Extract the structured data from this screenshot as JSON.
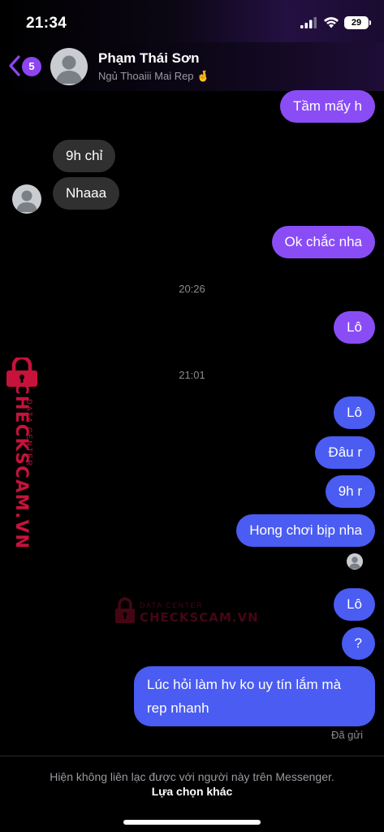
{
  "status_bar": {
    "time": "21:34",
    "battery": "29",
    "icons": [
      "signal-icon",
      "wifi-icon",
      "battery-icon"
    ]
  },
  "header": {
    "unread_count": "5",
    "contact_name": "Phạm Thái Sơn",
    "contact_status": "Ngủ Thoaiii Mai Rep 🤞",
    "icons": [
      "back-chevron-icon",
      "avatar-icon"
    ]
  },
  "messages": [
    {
      "text": "Tầm mấy h",
      "from": "me"
    },
    {
      "text": "9h chỉ",
      "from": "them"
    },
    {
      "text": "Nhaaa",
      "from": "them"
    },
    {
      "text": "Ok chắc nha",
      "from": "me"
    },
    {
      "text": "Lô",
      "from": "me"
    },
    {
      "text": "Lô",
      "from": "me"
    },
    {
      "text": "Đâu r",
      "from": "me"
    },
    {
      "text": "9h r",
      "from": "me"
    },
    {
      "text": "Hong chơi bịp nha",
      "from": "me"
    },
    {
      "text": "Lô",
      "from": "me"
    },
    {
      "text": "?",
      "from": "me"
    },
    {
      "text": "Lúc hỏi làm hv ko uy tín lắm mà rep nhanh",
      "from": "me"
    }
  ],
  "timestamps": [
    "20:26",
    "21:01"
  ],
  "delivered_label": "Đã gửi",
  "footer": {
    "note": "Hiện không liên lạc được với người này trên Messenger.",
    "action": "Lựa chọn khác"
  },
  "watermark": {
    "brand": "CHECKSCAM.VN",
    "sub": "DATA CENTER",
    "color": "#c7123b"
  },
  "colors": {
    "bubble_purple": "#8a4df5",
    "bubble_blue": "#4a5cf2",
    "bubble_incoming": "#303030",
    "badge": "#8e44f0"
  }
}
